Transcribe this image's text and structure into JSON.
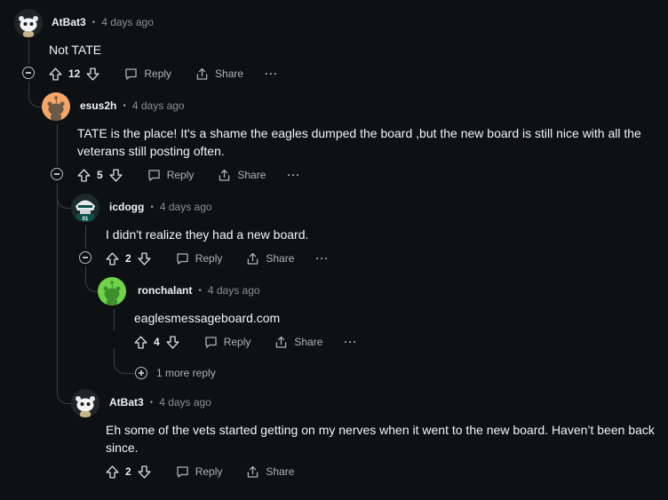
{
  "comments": [
    {
      "username": "AtBat3",
      "time": "4 days ago",
      "body": "Not TATE",
      "votes": "12",
      "reply_label": "Reply",
      "share_label": "Share",
      "more_label": "···",
      "avatar": "snoo-white"
    },
    {
      "username": "esus2h",
      "time": "4 days ago",
      "body": "TATE is the place! It's a shame the eagles dumped the board ,but the new board is still nice with all the veterans still posting often.",
      "votes": "5",
      "reply_label": "Reply",
      "share_label": "Share",
      "more_label": "···",
      "avatar": "snoo-orange"
    },
    {
      "username": "icdogg",
      "time": "4 days ago",
      "body": "I didn't realize they had a new board.",
      "votes": "2",
      "reply_label": "Reply",
      "share_label": "Share",
      "more_label": "···",
      "avatar": "eagles-player"
    },
    {
      "username": "ronchalant",
      "time": "4 days ago",
      "body": "eaglesmessageboard.com",
      "votes": "4",
      "reply_label": "Reply",
      "share_label": "Share",
      "more_label": "···",
      "avatar": "snoo-green"
    },
    {
      "username": "AtBat3",
      "time": "4 days ago",
      "body": "Eh some of the vets started getting on my nerves when it went to the new board. Haven’t been back since.",
      "votes": "2",
      "reply_label": "Reply",
      "share_label": "Share",
      "more_label": "···",
      "avatar": "snoo-white"
    }
  ],
  "more_replies_label": "1 more reply",
  "colors": {
    "background": "#0e1113",
    "thread_line": "#3a3f44",
    "text": "#f2f4f5",
    "muted": "#8a9196",
    "avatar_orange": "#f5a566",
    "avatar_green": "#6fd44a"
  }
}
